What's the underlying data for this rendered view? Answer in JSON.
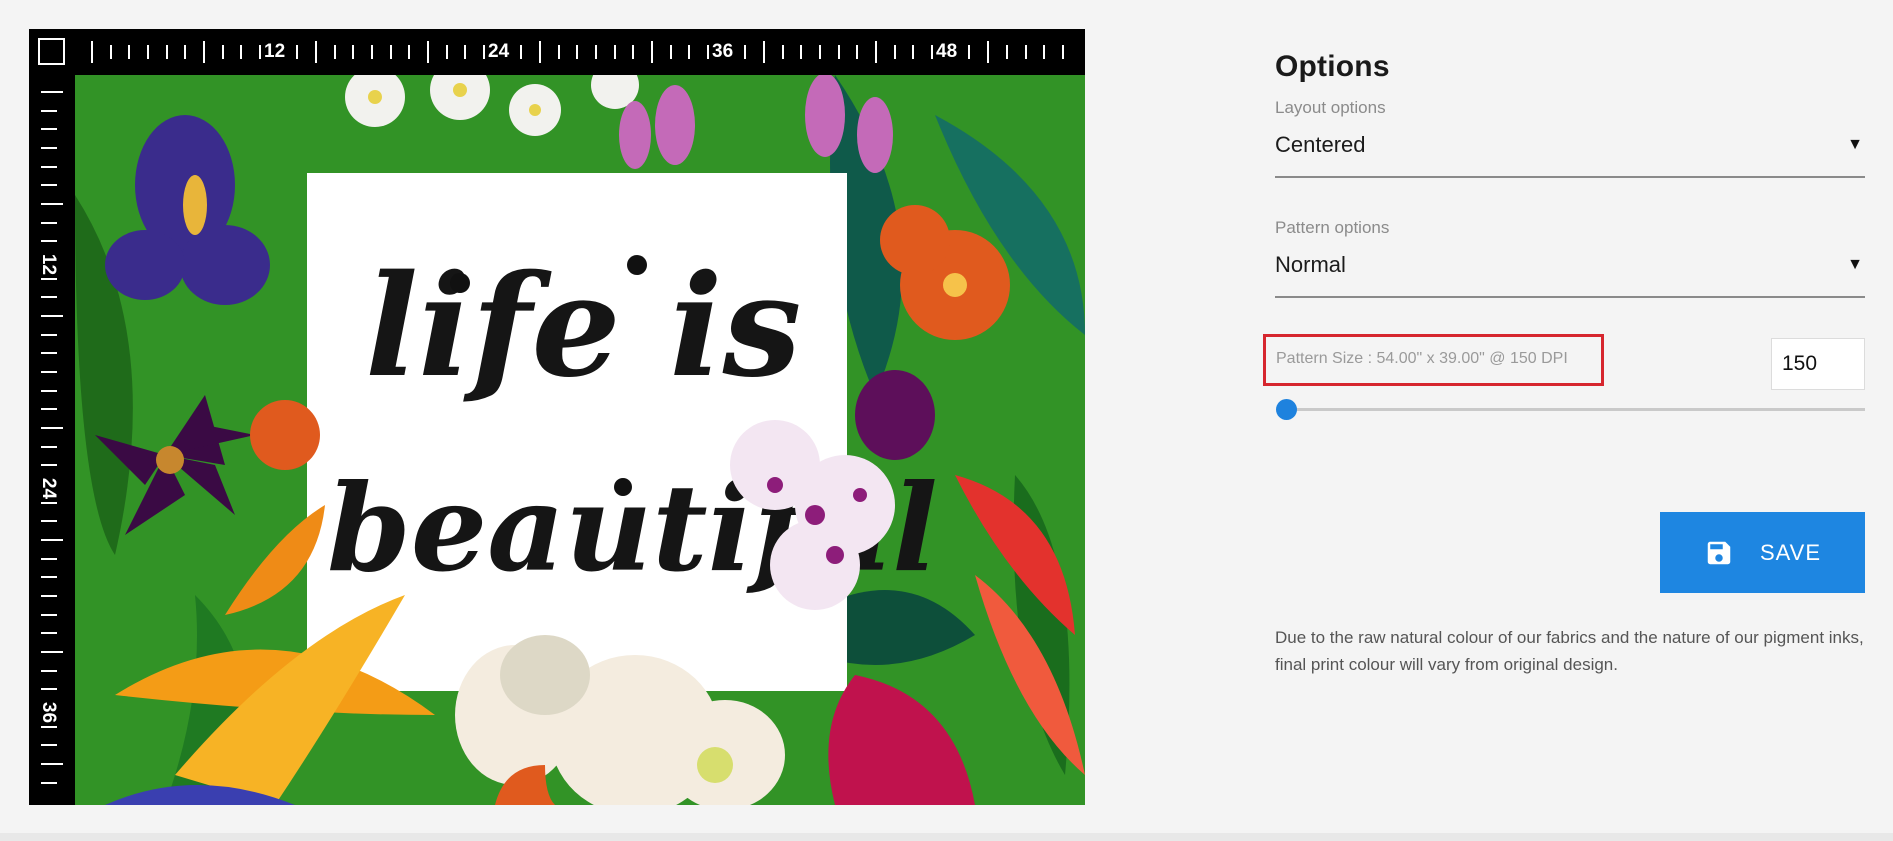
{
  "preview": {
    "top_ruler_labels": [
      "12",
      "24",
      "36",
      "48"
    ],
    "left_ruler_labels": [
      "12",
      "24",
      "36"
    ],
    "quote_line_1": "life is",
    "quote_line_2": "beautiful"
  },
  "options": {
    "title": "Options",
    "layout": {
      "label": "Layout options",
      "value": "Centered"
    },
    "pattern": {
      "label": "Pattern options",
      "value": "Normal"
    },
    "pattern_size_text": "Pattern Size : 54.00\" x 39.00\" @ 150 DPI",
    "dpi_value": "150",
    "slider_fraction": 0.0,
    "save_label": "SAVE",
    "disclaimer": "Due to the raw natural colour of our fabrics and the nature of our pigment inks, final print colour will vary from original design."
  },
  "colors": {
    "accent": "#1e86e1",
    "highlight_border": "#d6262e",
    "background": "#f4f4f4"
  },
  "icons": {
    "save": "floppy-disk-icon",
    "select_arrow": "triangle-down-icon"
  }
}
